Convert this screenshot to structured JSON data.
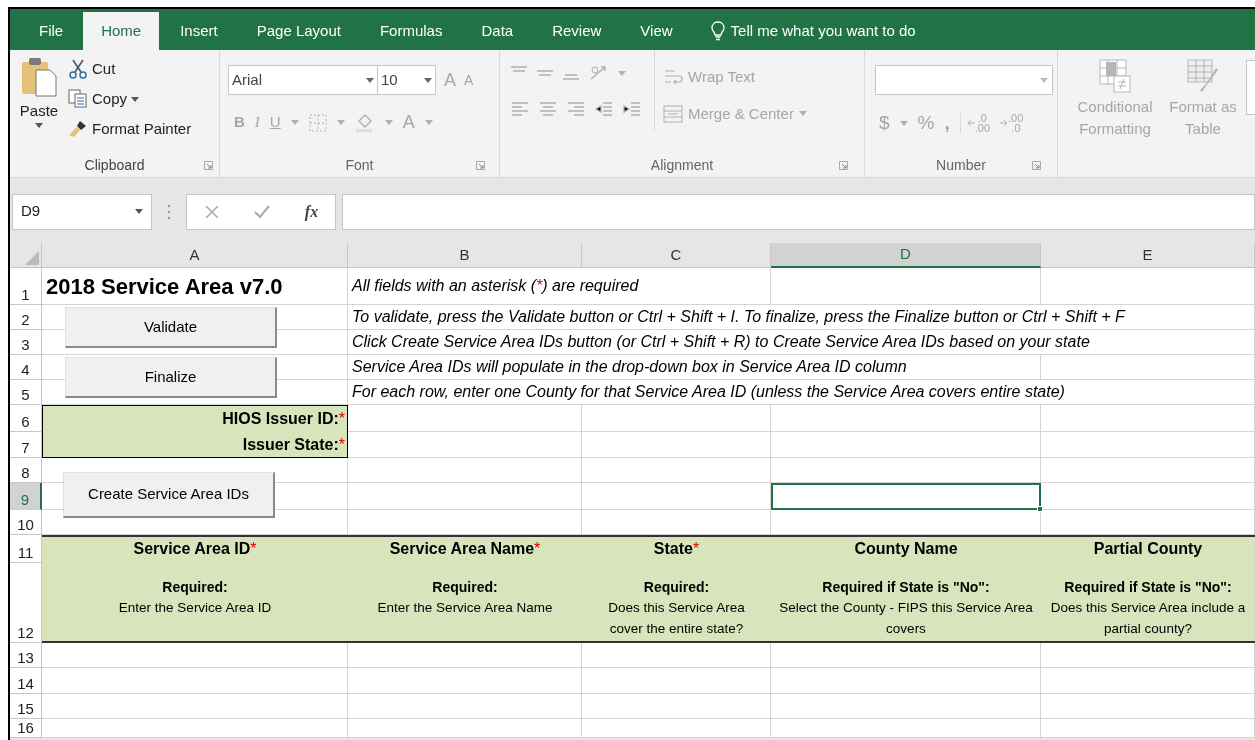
{
  "ribbon_tabs": [
    {
      "label": "File",
      "selected": false
    },
    {
      "label": "Home",
      "selected": true
    },
    {
      "label": "Insert",
      "selected": false
    },
    {
      "label": "Page Layout",
      "selected": false
    },
    {
      "label": "Formulas",
      "selected": false
    },
    {
      "label": "Data",
      "selected": false
    },
    {
      "label": "Review",
      "selected": false
    },
    {
      "label": "View",
      "selected": false
    }
  ],
  "tell_me": "Tell me what you want to do",
  "ribbon": {
    "clipboard": {
      "label": "Clipboard",
      "disabled": false,
      "paste": "Paste",
      "cut": "Cut",
      "copy": "Copy",
      "format_painter": "Format Painter"
    },
    "font": {
      "label": "Font",
      "disabled": true,
      "font_name": "Arial",
      "font_size": "10",
      "grow": "A",
      "shrink": "A",
      "bold": "B",
      "italic": "I",
      "underline": "U",
      "font_color": "A"
    },
    "alignment": {
      "label": "Alignment",
      "disabled": true,
      "wrap_text": "Wrap Text",
      "merge_center": "Merge & Center"
    },
    "number": {
      "label": "Number",
      "disabled": true,
      "currency": "$",
      "percent": "%",
      "comma": ",",
      "increase_decimal": {
        "top": ".0",
        "bottom": ".00"
      },
      "decrease_decimal": {
        "top": ".00",
        "bottom": ".0"
      }
    },
    "styles": {
      "disabled": true,
      "conditional_formatting": "Conditional Formatting",
      "format_as_table": "Format as Table"
    }
  },
  "formula_bar": {
    "name_box": "D9",
    "function_glyph": "fx"
  },
  "columns": [
    {
      "label": "A",
      "selected": false
    },
    {
      "label": "B",
      "selected": false
    },
    {
      "label": "C",
      "selected": false
    },
    {
      "label": "D",
      "selected": true
    },
    {
      "label": "E",
      "selected": false
    }
  ],
  "rows": [
    {
      "label": "1",
      "selected": false
    },
    {
      "label": "2",
      "selected": false
    },
    {
      "label": "3",
      "selected": false
    },
    {
      "label": "4",
      "selected": false
    },
    {
      "label": "5",
      "selected": false
    },
    {
      "label": "6",
      "selected": false
    },
    {
      "label": "7",
      "selected": false
    },
    {
      "label": "8",
      "selected": false
    },
    {
      "label": "9",
      "selected": true
    },
    {
      "label": "10",
      "selected": false
    },
    {
      "label": "11",
      "selected": false
    },
    {
      "label": "12",
      "selected": false
    },
    {
      "label": "13",
      "selected": false
    },
    {
      "label": "14",
      "selected": false
    },
    {
      "label": "15",
      "selected": false
    },
    {
      "label": "16",
      "selected": false
    }
  ],
  "title": "2018 Service Area v7.0",
  "required_note": {
    "before": "All fields with an asterisk (",
    "asterisk": "*",
    "after": ") are required"
  },
  "instructions": [
    "To validate, press the Validate button or Ctrl + Shift + I. To finalize, press the Finalize button or Ctrl + Shift + F",
    "Click Create Service Area IDs button (or Ctrl + Shift + R) to Create Service Area IDs based on your state",
    "Service Area IDs will populate in the drop-down box in Service Area ID column",
    "For each row, enter one County for that Service Area ID (unless the Service Area covers entire state)"
  ],
  "buttons": [
    "Validate",
    "Finalize",
    "Create Service Area IDs"
  ],
  "issuer_fields": [
    {
      "label": "HIOS Issuer ID:",
      "asterisk": "*"
    },
    {
      "label": "Issuer State:",
      "asterisk": "*"
    }
  ],
  "table_headers": [
    {
      "title": "Service Area ID",
      "asterisk": "*",
      "requirement": "Required:",
      "hint": "Enter the Service Area ID"
    },
    {
      "title": "Service Area Name",
      "asterisk": "*",
      "requirement": "Required:",
      "hint": "Enter the Service Area Name"
    },
    {
      "title": "State",
      "asterisk": "*",
      "requirement": "Required:",
      "hint": "Does this Service Area cover the entire state?"
    },
    {
      "title": "County Name",
      "requirement": "Required if State is \"No\":",
      "hint": "Select the County - FIPS this Service Area covers"
    },
    {
      "title": "Partial County",
      "requirement": "Required if State is \"No\":",
      "hint": "Does this Service Area include a partial county?"
    }
  ]
}
